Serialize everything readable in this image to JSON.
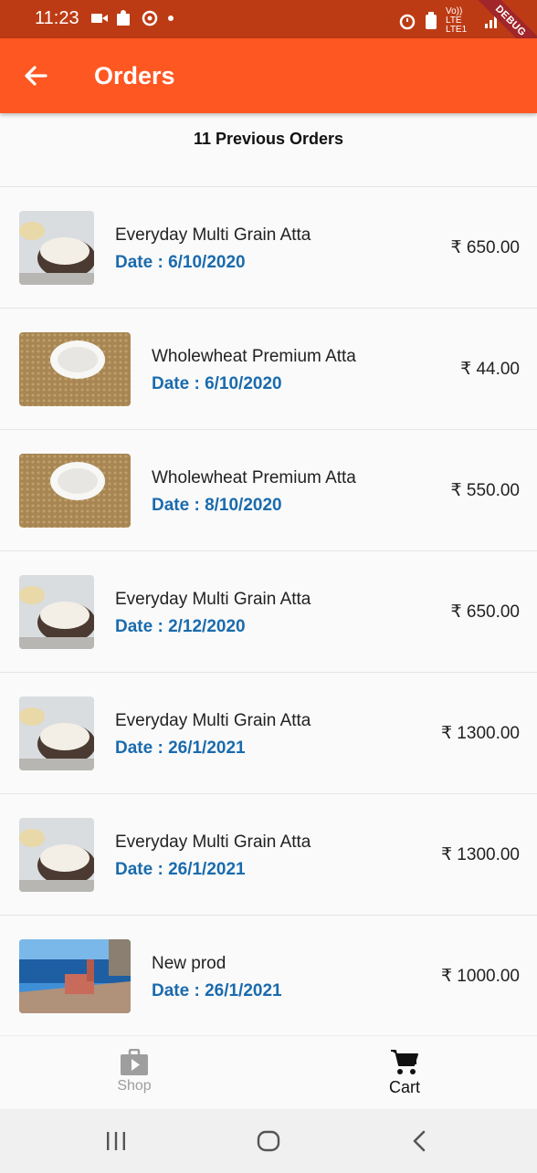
{
  "status_bar": {
    "time": "11:23",
    "network": "Vo)) LTE LTE1",
    "debug_label": "DEBUG"
  },
  "app_bar": {
    "title": "Orders",
    "back_icon": "arrow-back-icon"
  },
  "orders_header": "11 Previous Orders",
  "orders": [
    {
      "name": "Everyday Multi Grain Atta",
      "date": "Date : 6/10/2020",
      "price": "₹ 650.00",
      "image": "multigrain"
    },
    {
      "name": "Wholewheat Premium Atta",
      "date": "Date : 6/10/2020",
      "price": "₹ 44.00",
      "image": "wholewheat"
    },
    {
      "name": "Wholewheat Premium Atta",
      "date": "Date : 8/10/2020",
      "price": "₹ 550.00",
      "image": "wholewheat"
    },
    {
      "name": "Everyday Multi Grain Atta",
      "date": "Date : 2/12/2020",
      "price": "₹ 650.00",
      "image": "multigrain"
    },
    {
      "name": "Everyday Multi Grain Atta",
      "date": "Date : 26/1/2021",
      "price": "₹ 1300.00",
      "image": "multigrain"
    },
    {
      "name": "Everyday Multi Grain Atta",
      "date": "Date : 26/1/2021",
      "price": "₹ 1300.00",
      "image": "multigrain"
    },
    {
      "name": "New prod",
      "date": "Date : 26/1/2021",
      "price": "₹ 1000.00",
      "image": "seaside"
    }
  ],
  "bottom_nav": {
    "shop_label": "Shop",
    "cart_label": "Cart",
    "shop_icon": "shop-bag-icon",
    "cart_icon": "cart-icon"
  },
  "colors": {
    "status_bar": "#bd3b14",
    "app_bar": "#fe5722",
    "date_text": "#1a6bad"
  }
}
